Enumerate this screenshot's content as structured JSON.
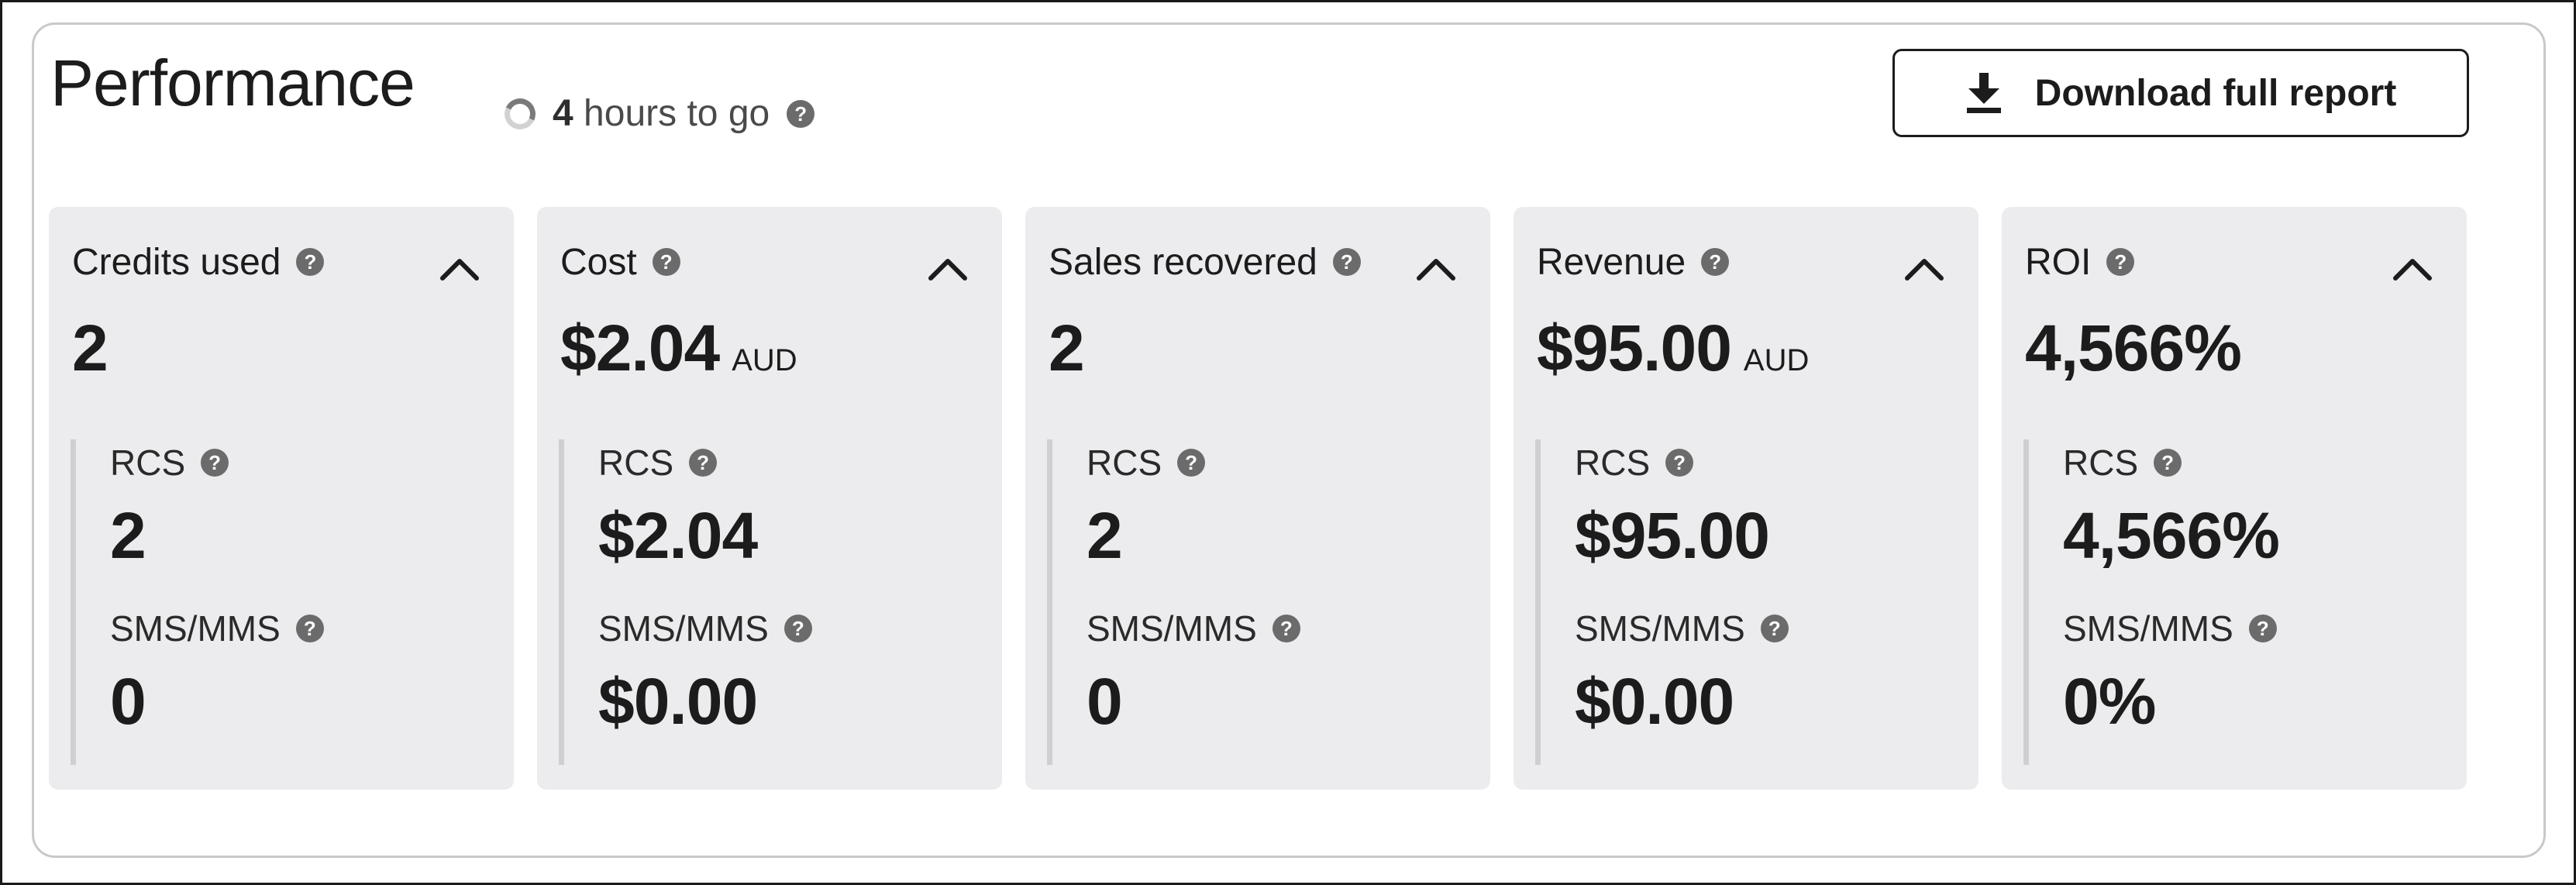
{
  "header": {
    "title": "Performance",
    "status_prefix": "4",
    "status_suffix": "hours to go",
    "download_label": "Download full report"
  },
  "icons": {
    "help": "question-circle-icon",
    "collapse": "chevron-up-icon",
    "download": "download-icon",
    "loading": "spinner-icon"
  },
  "colors": {
    "card_bg": "#ececee",
    "help_icon": "#6b6b6b",
    "text": "#1c1c1c"
  },
  "cards": [
    {
      "label": "Credits used",
      "value": "2",
      "unit": "",
      "rows": [
        {
          "label": "RCS",
          "value": "2"
        },
        {
          "label": "SMS/MMS",
          "value": "0"
        }
      ]
    },
    {
      "label": "Cost",
      "value": "$2.04",
      "unit": "AUD",
      "rows": [
        {
          "label": "RCS",
          "value": "$2.04"
        },
        {
          "label": "SMS/MMS",
          "value": "$0.00"
        }
      ]
    },
    {
      "label": "Sales recovered",
      "value": "2",
      "unit": "",
      "rows": [
        {
          "label": "RCS",
          "value": "2"
        },
        {
          "label": "SMS/MMS",
          "value": "0"
        }
      ]
    },
    {
      "label": "Revenue",
      "value": "$95.00",
      "unit": "AUD",
      "rows": [
        {
          "label": "RCS",
          "value": "$95.00"
        },
        {
          "label": "SMS/MMS",
          "value": "$0.00"
        }
      ]
    },
    {
      "label": "ROI",
      "value": "4,566%",
      "unit": "",
      "rows": [
        {
          "label": "RCS",
          "value": "4,566%"
        },
        {
          "label": "SMS/MMS",
          "value": "0%"
        }
      ]
    }
  ]
}
